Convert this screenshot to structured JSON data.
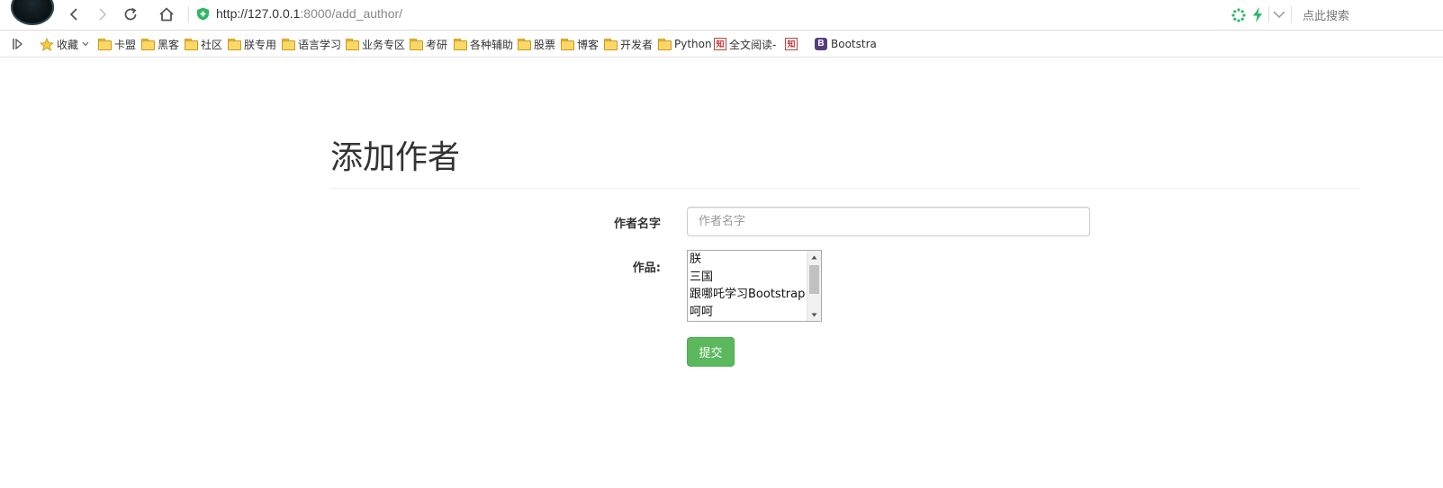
{
  "browser": {
    "url_host": "http://127.0.0.1",
    "url_path": ":8000/add_author/",
    "search_placeholder": "点此搜索"
  },
  "bookmarks": {
    "favorites_label": "收藏",
    "items": [
      {
        "label": "卡盟",
        "icon": "folder-icon"
      },
      {
        "label": "黑客",
        "icon": "folder-icon"
      },
      {
        "label": "社区",
        "icon": "folder-icon"
      },
      {
        "label": "朕专用",
        "icon": "folder-icon"
      },
      {
        "label": "语言学习",
        "icon": "folder-icon"
      },
      {
        "label": "业务专区",
        "icon": "folder-icon"
      },
      {
        "label": "考研",
        "icon": "folder-icon"
      },
      {
        "label": "各种辅助",
        "icon": "folder-icon"
      },
      {
        "label": "股票",
        "icon": "folder-icon"
      },
      {
        "label": "博客",
        "icon": "folder-icon"
      },
      {
        "label": "开发者",
        "icon": "folder-icon"
      },
      {
        "label": "Python",
        "icon": "folder-icon"
      },
      {
        "label": "全文阅读-",
        "icon": "zhihu-icon"
      },
      {
        "label": "",
        "icon": "zhihu-icon"
      },
      {
        "label": "Bootstra",
        "icon": "bootstrap-icon"
      }
    ]
  },
  "page": {
    "title": "添加作者",
    "name_label": "作者名字",
    "name_placeholder": "作者名字",
    "works_label": "作品:",
    "works_options": [
      "朕",
      "三国",
      "跟哪吒学习Bootstrap",
      "呵呵"
    ],
    "submit_label": "提交"
  },
  "colors": {
    "submit_green": "#5cb85c",
    "shield_green": "#2fb567",
    "bootstrap_purple": "#563d7c"
  }
}
